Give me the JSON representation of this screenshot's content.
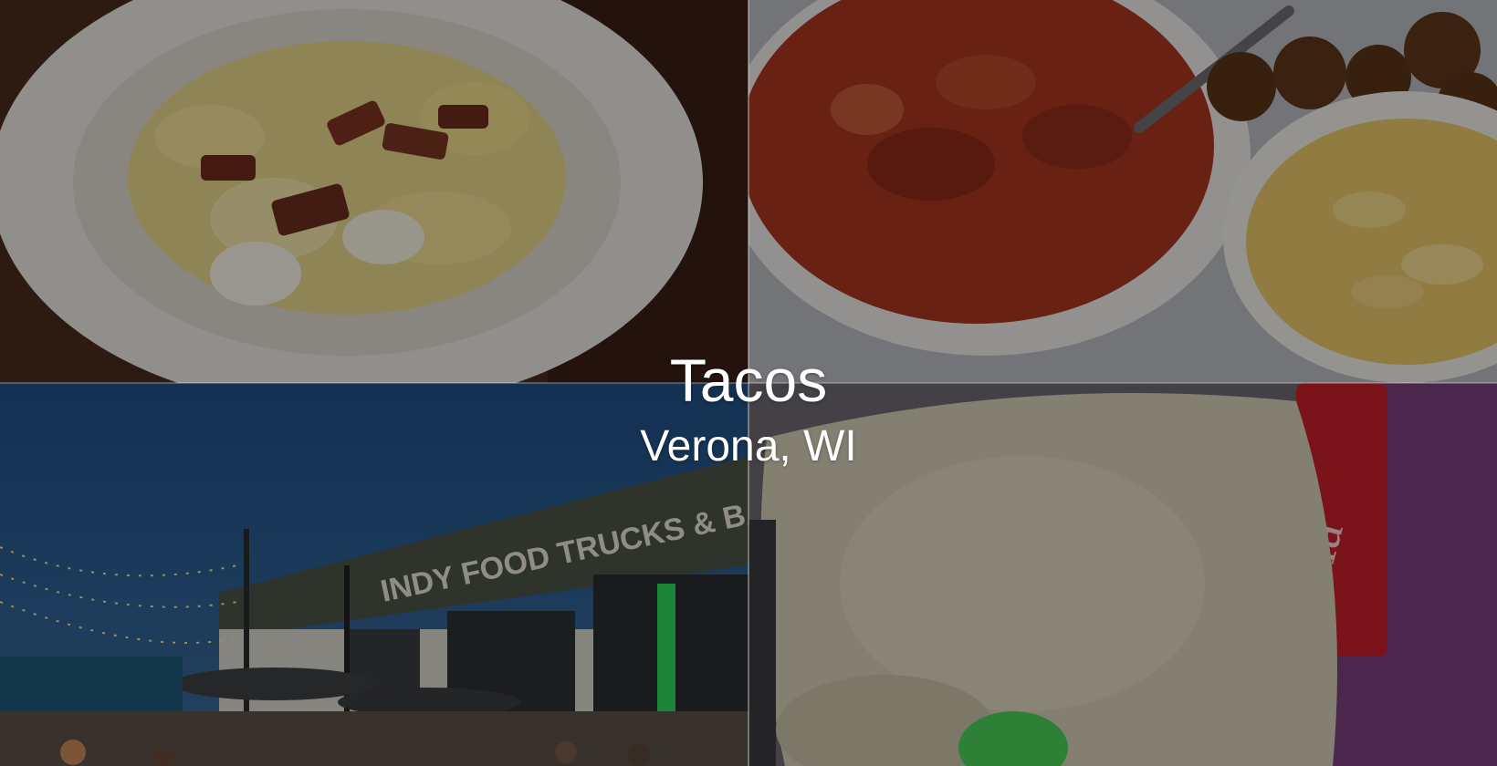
{
  "hero": {
    "title": "Tacos",
    "subtitle": "Verona, WI"
  },
  "photos": [
    {
      "label": "pasta-photo"
    },
    {
      "label": "gumbo-photo"
    },
    {
      "label": "food-trucks-bar-photo",
      "sign_text": "INDY FOOD TRUCKS & BAR"
    },
    {
      "label": "tortilla-chip-photo"
    }
  ],
  "colors": {
    "overlay": "#000000",
    "text": "#ffffff"
  }
}
